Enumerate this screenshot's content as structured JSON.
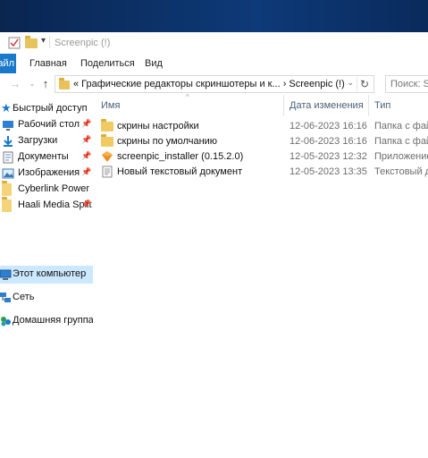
{
  "window": {
    "title": "Screenpic (!)"
  },
  "ribbon": {
    "file_tab": "айл",
    "tabs": [
      "Главная",
      "Поделиться",
      "Вид"
    ]
  },
  "address": {
    "crumbs": "«  Графические редакторы скриншотеры и к...  ›  Screenpic (!)"
  },
  "search": {
    "placeholder": "Поиск: Sc"
  },
  "navigation": {
    "quick_access": "Быстрый доступ",
    "pinned": [
      {
        "label": "Рабочий стол",
        "icon": "desktop-icon"
      },
      {
        "label": "Загрузки",
        "icon": "download-icon"
      },
      {
        "label": "Документы",
        "icon": "documents-icon"
      },
      {
        "label": "Изображения",
        "icon": "pictures-icon"
      },
      {
        "label": "Cyberlink Power",
        "icon": "folder-icon"
      },
      {
        "label": "Haali Media Split",
        "icon": "folder-icon"
      }
    ],
    "this_pc": "Этот компьютер",
    "network": "Сеть",
    "homegroup": "Домашняя группа"
  },
  "columns": {
    "name": "Имя",
    "date": "Дата изменения",
    "type": "Тип"
  },
  "files": [
    {
      "name": "скрины настройки",
      "date": "12-06-2023 16:16",
      "type": "Папка с фай",
      "icon": "folder-icon"
    },
    {
      "name": "скрины по умолчанию",
      "date": "12-06-2023 16:16",
      "type": "Папка с фай",
      "icon": "folder-icon"
    },
    {
      "name": "screenpic_installer (0.15.2.0)",
      "date": "12-05-2023 12:32",
      "type": "Приложение",
      "icon": "installer-icon"
    },
    {
      "name": "Новый текстовый документ",
      "date": "12-05-2023 13:35",
      "type": "Текстовый до",
      "icon": "text-file-icon"
    }
  ],
  "colors": {
    "accent": "#1979ca",
    "selection": "#cce8ff",
    "folder": "#e8c25a"
  }
}
